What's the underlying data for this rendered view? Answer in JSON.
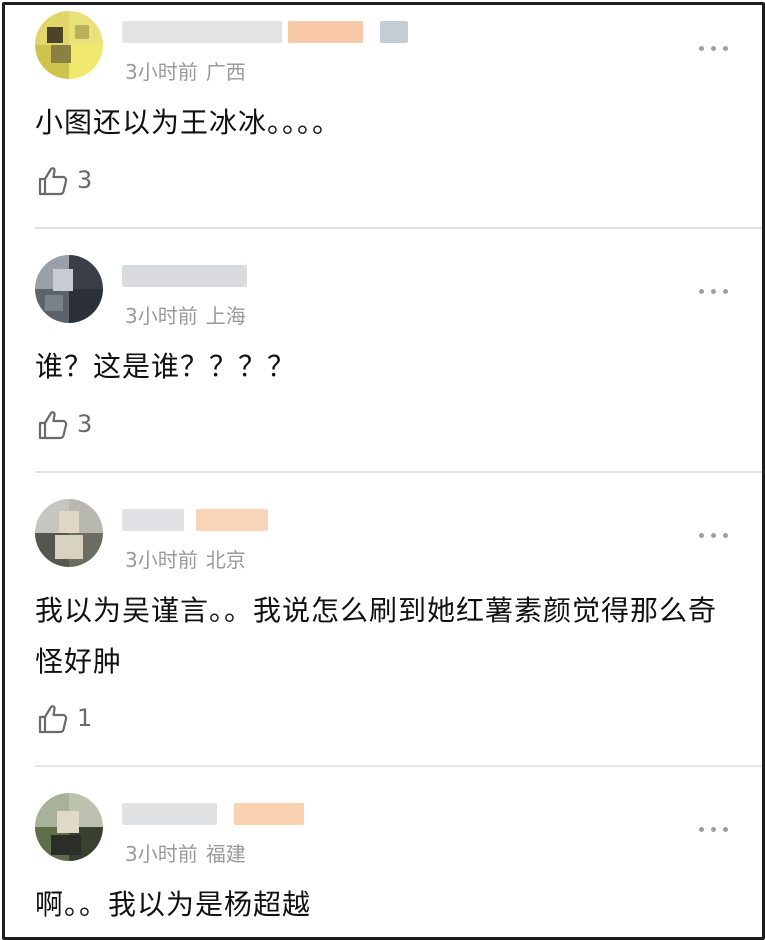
{
  "comments": [
    {
      "time": "3小时前",
      "location": "广西",
      "text": "小图还以为王冰冰。。。。",
      "likes": "3"
    },
    {
      "time": "3小时前",
      "location": "上海",
      "text": "谁？这是谁？？？？",
      "likes": "3"
    },
    {
      "time": "3小时前",
      "location": "北京",
      "text": "我以为吴谨言。。我说怎么刷到她红薯素颜觉得那么奇怪好肿",
      "likes": "1"
    },
    {
      "time": "3小时前",
      "location": "福建",
      "text": "啊。。我以为是杨超越"
    }
  ],
  "icons": {
    "like": "thumbs-up-icon",
    "more": "more-dots-icon",
    "avatar": "pixelated-avatar"
  },
  "colors": {
    "text": "#111111",
    "meta": "#9a9a9a",
    "divider": "#e4e4e4",
    "badge": "#f7c9a8"
  }
}
